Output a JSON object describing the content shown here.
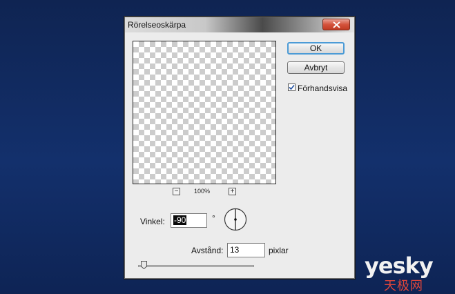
{
  "dialog": {
    "title": "Rörelseoskärpa",
    "zoom_level": "100%",
    "buttons": {
      "ok": "OK",
      "cancel": "Avbryt"
    },
    "preview_checkbox": {
      "label": "Förhandsvisa",
      "checked": true
    },
    "angle": {
      "label": "Vinkel:",
      "value": "-90",
      "unit": "°"
    },
    "distance": {
      "label": "Avstånd:",
      "value": "13",
      "unit": "pixlar"
    }
  },
  "watermark": {
    "main": "yesky",
    "sub": "天极网"
  }
}
